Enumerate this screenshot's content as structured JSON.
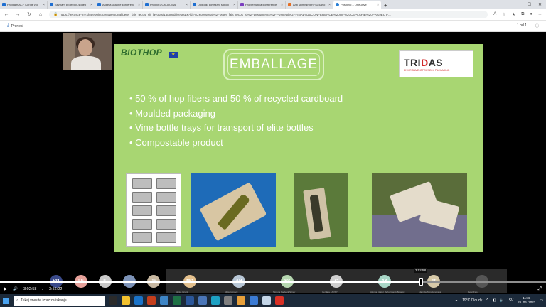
{
  "browser": {
    "tabs": [
      {
        "label": "Program ACF Kordis vro",
        "fav": "blue"
      },
      {
        "label": "Seznam projektov-sodeo",
        "fav": "blue"
      },
      {
        "label": "Anketa ustalne konferenc",
        "fav": "blue"
      },
      {
        "label": "Projekt DOM-DOMA",
        "fav": "blue"
      },
      {
        "label": "Dogodki povezani s podj",
        "fav": "blue"
      },
      {
        "label": "Problematica konference",
        "fav": "purple"
      },
      {
        "label": "Anti skimming RFID karto",
        "fav": "orange"
      },
      {
        "label": "Posnetki – OneDrive",
        "fav": "cloud",
        "active": true
      }
    ],
    "new_tab": "+",
    "url": "https://tecosce-my.sharepoint.com/personal/peter_fajs_tecos_si/_layouts/15/onedrive.aspx?id=%2Fpersonal%2Fpeter_fajs_tecos_si%2FDocuments%2FPosnetki%2FFINAL%20CONFERENCE%20OF%20CEPLAFIB%20PROJECT-..."
  },
  "doc_toolbar": {
    "download_label": "Prenesi",
    "page_indicator": "1 od 1"
  },
  "slide": {
    "logo_text": "BIOTHOP",
    "title": "EMBALLAGE",
    "partner_logo": {
      "name_pre": "TRI",
      "name_accent": "D",
      "name_post": "AS",
      "subtitle": "ENVIRONMENTFRIENDLY PACKAGING"
    },
    "bullets": [
      "50 % of hop fibers and 50 % of recycled cardboard",
      "Moulded packaging",
      "Vine bottle trays for transport of elite bottles",
      "Compostable product"
    ]
  },
  "participants": [
    {
      "initials": "+31",
      "color": "#3a4a8a",
      "name": ""
    },
    {
      "initials": "LE",
      "color": "#e6a19a",
      "name": ""
    },
    {
      "initials": "IL",
      "color": "#c9c9c9",
      "name": ""
    },
    {
      "initials": "",
      "color": "#7d93b8",
      "name": ""
    },
    {
      "initials": "JF",
      "color": "#c7b7a0",
      "name": ""
    },
    {
      "initials": "MO",
      "color": "#e3c08d",
      "name": "Marko Ocvirk"
    },
    {
      "initials": "AH",
      "color": "#b8c7d6",
      "name": "Ali Herdinovic"
    },
    {
      "initials": "SV",
      "color": "#b6d7b0",
      "name": "Simona Kadlecik Strner"
    },
    {
      "initials": "C",
      "color": "#cfcfcf",
      "name": "Cerdara - ACSP"
    },
    {
      "initials": "AK",
      "color": "#a8d6c6",
      "name": "Alenka Kiratur, Jerko Marek Bojanic"
    },
    {
      "initials": "JT",
      "color": "#d7c9a8",
      "name": "Jarmila Tomazenovska"
    },
    {
      "initials": "",
      "color": "#555555",
      "name": "Peter Fajs"
    }
  ],
  "player": {
    "current_time": "3:02:58",
    "total_time": "3:56:22",
    "hover_time": "3:02:58",
    "progress": 0.773
  },
  "taskbar": {
    "search_placeholder": "Tukaj vnesite izraz za iskanje",
    "weather": "19°C  Cloudy",
    "language": "SV",
    "time": "11:33",
    "date": "26. 06. 2021"
  }
}
